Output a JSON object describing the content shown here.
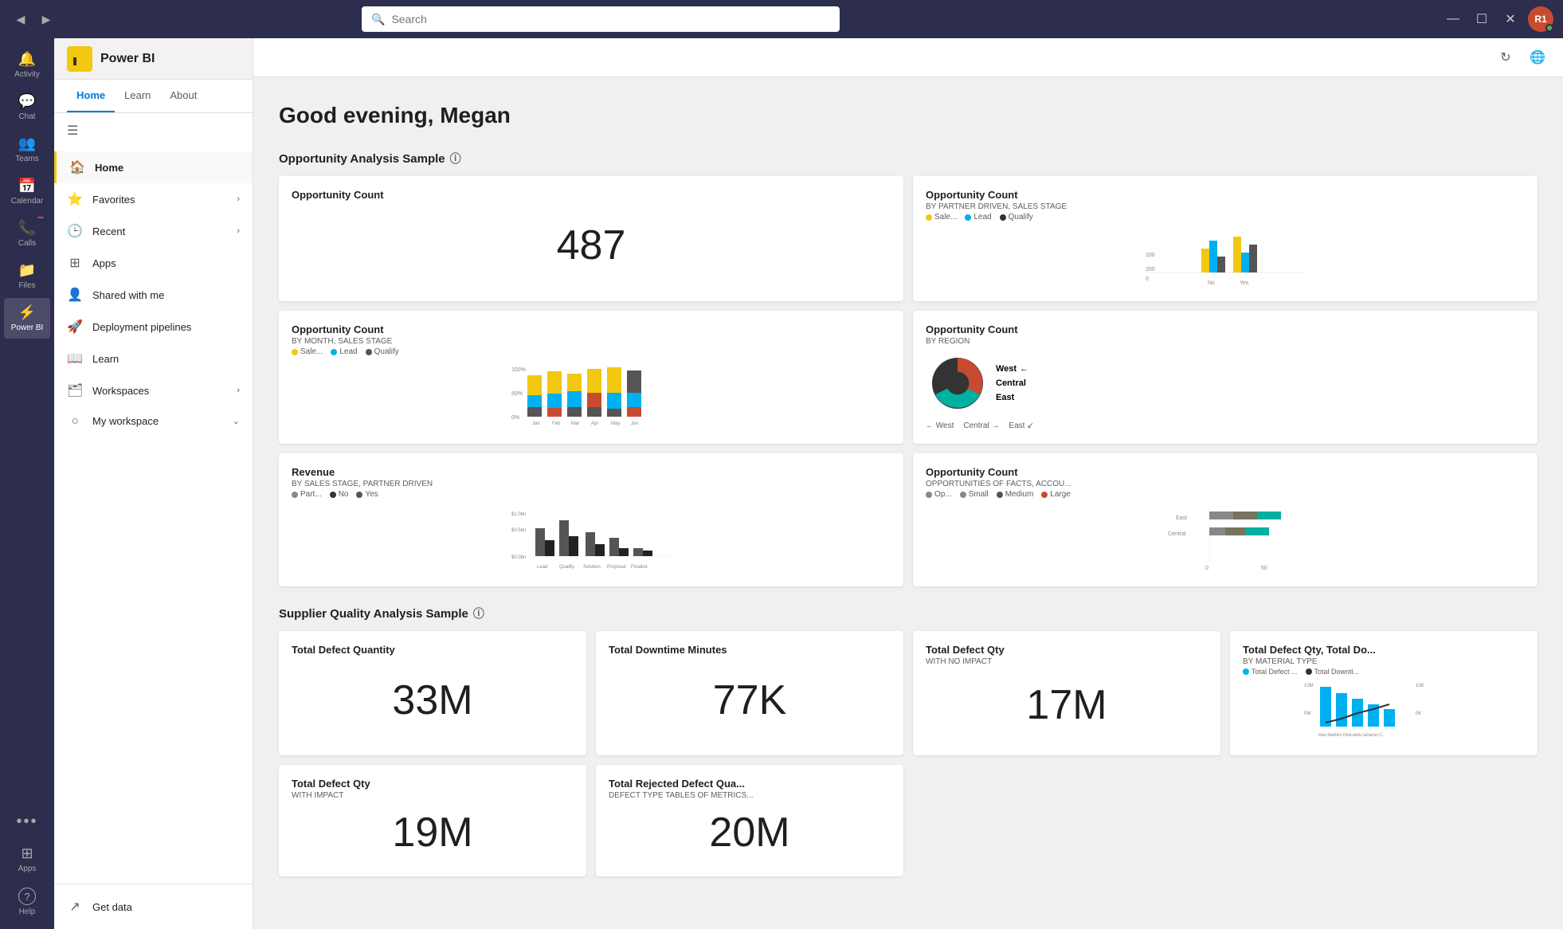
{
  "titlebar": {
    "search_placeholder": "Search",
    "back_label": "◀",
    "forward_label": "▶",
    "minimize": "—",
    "maximize": "☐",
    "close": "✕"
  },
  "teams_sidebar": {
    "items": [
      {
        "id": "activity",
        "label": "Activity",
        "icon": "🔔",
        "active": false
      },
      {
        "id": "chat",
        "label": "Chat",
        "icon": "💬",
        "active": false
      },
      {
        "id": "teams",
        "label": "Teams",
        "icon": "👥",
        "active": false
      },
      {
        "id": "calendar",
        "label": "Calendar",
        "icon": "📅",
        "active": false
      },
      {
        "id": "calls",
        "label": "Calls",
        "icon": "📞",
        "active": false,
        "badge": ""
      },
      {
        "id": "files",
        "label": "Files",
        "icon": "📁",
        "active": false
      },
      {
        "id": "powerbi",
        "label": "Power BI",
        "icon": "⚡",
        "active": true
      },
      {
        "id": "more",
        "label": "...",
        "icon": "···",
        "active": false
      },
      {
        "id": "apps",
        "label": "Apps",
        "icon": "⊞",
        "active": false
      },
      {
        "id": "help",
        "label": "Help",
        "icon": "?",
        "active": false
      }
    ]
  },
  "pbi_sidebar": {
    "logo_icon": "⚡",
    "title": "Power BI",
    "nav_tabs": [
      {
        "id": "home",
        "label": "Home",
        "active": true
      },
      {
        "id": "learn",
        "label": "Learn",
        "active": false
      },
      {
        "id": "about",
        "label": "About",
        "active": false
      }
    ],
    "menu_items": [
      {
        "id": "home",
        "label": "Home",
        "icon": "🏠",
        "active": true,
        "chevron": false
      },
      {
        "id": "favorites",
        "label": "Favorites",
        "icon": "⭐",
        "active": false,
        "chevron": true
      },
      {
        "id": "recent",
        "label": "Recent",
        "icon": "🕒",
        "active": false,
        "chevron": true
      },
      {
        "id": "apps",
        "label": "Apps",
        "icon": "⊞",
        "active": false,
        "chevron": false
      },
      {
        "id": "shared",
        "label": "Shared with me",
        "icon": "👤",
        "active": false,
        "chevron": false
      },
      {
        "id": "deployment",
        "label": "Deployment pipelines",
        "icon": "🚀",
        "active": false,
        "chevron": false
      },
      {
        "id": "learn",
        "label": "Learn",
        "icon": "📖",
        "active": false,
        "chevron": false
      },
      {
        "id": "workspaces",
        "label": "Workspaces",
        "icon": "🗂",
        "active": false,
        "chevron": true
      },
      {
        "id": "myworkspace",
        "label": "My workspace",
        "icon": "👤",
        "active": false,
        "chevron": true
      }
    ],
    "bottom_items": [
      {
        "id": "getdata",
        "label": "Get data",
        "icon": "↗"
      }
    ]
  },
  "main": {
    "greeting": "Good evening, ",
    "user_name": "Megan",
    "sections": [
      {
        "id": "opportunity",
        "title": "Opportunity Analysis Sample",
        "cards": [
          {
            "id": "opp-count",
            "title": "Opportunity Count",
            "subtitle": "",
            "type": "number",
            "value": "487"
          },
          {
            "id": "opp-count-partner",
            "title": "Opportunity Count",
            "subtitle": "BY PARTNER DRIVEN, SALES STAGE",
            "type": "bar-chart",
            "legend": [
              {
                "label": "Sale...",
                "color": "#f2c811"
              },
              {
                "label": "Lead",
                "color": "#00b0f0"
              },
              {
                "label": "Qualify",
                "color": "#333"
              }
            ]
          },
          {
            "id": "opp-count-month",
            "title": "Opportunity Count",
            "subtitle": "BY MONTH, SALES STAGE",
            "type": "stacked-bar",
            "legend": [
              {
                "label": "Sale...",
                "color": "#f2c811"
              },
              {
                "label": "Lead",
                "color": "#00b0f0"
              },
              {
                "label": "Qualify",
                "color": "#555"
              }
            ]
          },
          {
            "id": "opp-count-region",
            "title": "Opportunity Count",
            "subtitle": "BY REGION",
            "type": "pie",
            "legend": [
              {
                "label": "West",
                "color": "#c84b31"
              },
              {
                "label": "Central",
                "color": "#00b0a0"
              },
              {
                "label": "East",
                "color": "#333"
              }
            ]
          },
          {
            "id": "revenue",
            "title": "Revenue",
            "subtitle": "BY SALES STAGE, PARTNER DRIVEN",
            "type": "bar-revenue",
            "legend": [
              {
                "label": "Part...",
                "color": "#888"
              },
              {
                "label": "No",
                "color": "#333"
              },
              {
                "label": "Yes",
                "color": "#555"
              }
            ]
          },
          {
            "id": "opp-count-facts",
            "title": "Opportunity Count",
            "subtitle": "OPPORTUNITIES OF FACTS, ACCOU...",
            "type": "bar-horizontal",
            "legend": [
              {
                "label": "Op...",
                "color": "#888"
              },
              {
                "label": "Small",
                "color": "#888"
              },
              {
                "label": "Medium",
                "color": "#333"
              },
              {
                "label": "Large",
                "color": "#c84b31"
              }
            ]
          }
        ]
      },
      {
        "id": "supplier",
        "title": "Supplier Quality Analysis Sample",
        "cards": [
          {
            "id": "total-defect",
            "title": "Total Defect Quantity",
            "type": "number",
            "value": "33M"
          },
          {
            "id": "total-downtime",
            "title": "Total Downtime Minutes",
            "type": "number",
            "value": "77K"
          },
          {
            "id": "defect-qty-no-impact",
            "title": "Total Defect Qty",
            "subtitle": "WITH NO IMPACT",
            "type": "number",
            "value": "17M"
          },
          {
            "id": "defect-qty-material",
            "title": "Total Defect Qty, Total Do...",
            "subtitle": "BY MATERIAL TYPE",
            "type": "line-bar",
            "legend": [
              {
                "label": "Total Defect ...",
                "color": "#00b0f0"
              },
              {
                "label": "Total Downti...",
                "color": "#333"
              }
            ]
          },
          {
            "id": "defect-qty-impact",
            "title": "Total Defect Qty",
            "subtitle": "WITH IMPACT",
            "type": "number",
            "value": "19M"
          },
          {
            "id": "rejected-defect",
            "title": "Total Rejected Defect Qua...",
            "subtitle": "DEFECT TYPE TABLES OF METRICS...",
            "type": "number",
            "value": "20M"
          }
        ]
      }
    ]
  }
}
